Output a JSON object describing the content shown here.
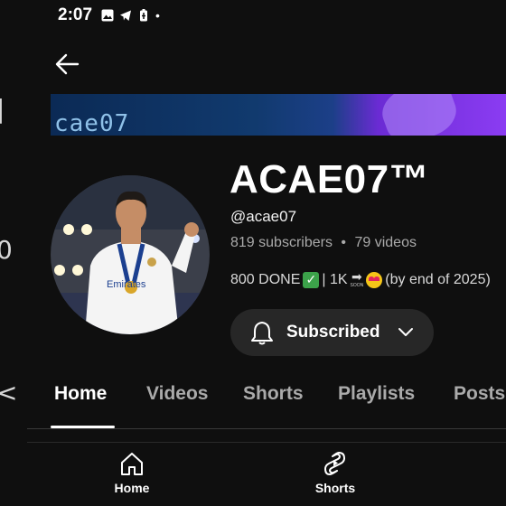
{
  "status_bar": {
    "time": "2:07",
    "dot": "•"
  },
  "left_edge": {
    "glyphs": [
      "|",
      "0",
      "<"
    ]
  },
  "banner": {
    "text": "cae07"
  },
  "channel": {
    "name": "ACAE07™",
    "handle": "@acae07",
    "subscribers": "819 subscribers",
    "separator": "•",
    "videos": "79 videos",
    "description": {
      "part1": "800 DONE",
      "check": "✓",
      "part2": "| 1K",
      "arrow": "➡",
      "soon": "SOON",
      "part3": "(by end of 2025)"
    }
  },
  "subscribe_button": {
    "label": "Subscribed"
  },
  "tabs": [
    {
      "label": "Home",
      "active": true
    },
    {
      "label": "Videos"
    },
    {
      "label": "Shorts"
    },
    {
      "label": "Playlists"
    },
    {
      "label": "Posts"
    }
  ],
  "bottom_nav": [
    {
      "label": "Home",
      "icon": "home-icon"
    },
    {
      "label": "Shorts",
      "icon": "shorts-icon"
    }
  ],
  "colors": {
    "background": "#0f0f0f",
    "button": "#272727",
    "secondary_text": "#aaaaaa"
  }
}
